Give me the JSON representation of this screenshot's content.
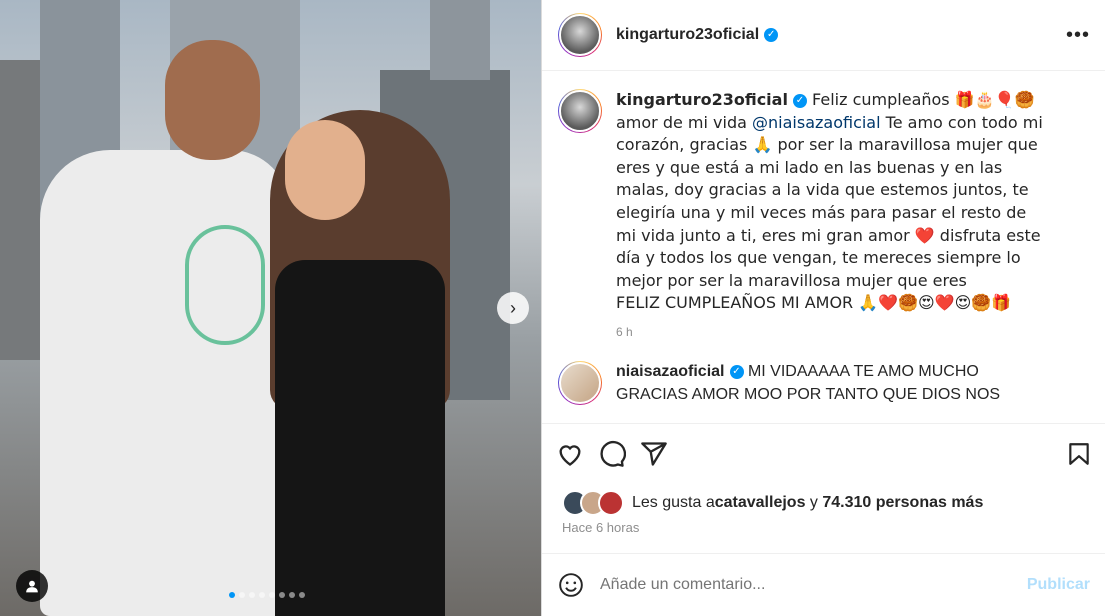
{
  "post": {
    "author": "kingarturo23oficial",
    "carousel": {
      "total_slides": 8,
      "active_slide": 1
    }
  },
  "caption": {
    "author": "kingarturo23oficial",
    "part1": "Feliz cumpleaños 🎁🎂🎈🥮",
    "part2": "amor de mi vida ",
    "mention": "@niaisazaoficial",
    "part3": " Te amo con todo mi corazón, gracias 🙏 por ser la maravillosa mujer que eres y que está a mi lado en las buenas y en las malas, doy gracias a la vida que estemos juntos, te elegiría una y mil veces más para pasar el resto de mi vida junto a ti, eres mi gran amor ❤️ disfruta este día y todos los que vengan, te mereces siempre lo mejor por ser la maravillosa mujer que eres",
    "part4": "FELIZ CUMPLEAÑOS MI AMOR 🙏❤️🥮😍❤️😍🥮🎁",
    "time": "6 h"
  },
  "comment": {
    "author": "niaisazaoficial",
    "text": "MI VIDAAAAA TE AMO MUCHO GRACIAS AMOR MOO POR TANTO QUE DIOS NOS"
  },
  "likes": {
    "prefix": "Les gusta a ",
    "user": "catavallejos",
    "middle": " y ",
    "count": "74.310 personas más"
  },
  "time_ago": "Hace 6 horas",
  "composer": {
    "placeholder": "Añade un comentario...",
    "publish_label": "Publicar"
  },
  "colors": {
    "accent": "#0095f6",
    "publish_disabled": "#b2dffc"
  },
  "icons": [
    "more-icon",
    "heart-icon",
    "comment-icon",
    "share-icon",
    "save-icon",
    "emoji-icon",
    "tag-user-icon",
    "next-arrow-icon",
    "verified-icon"
  ]
}
